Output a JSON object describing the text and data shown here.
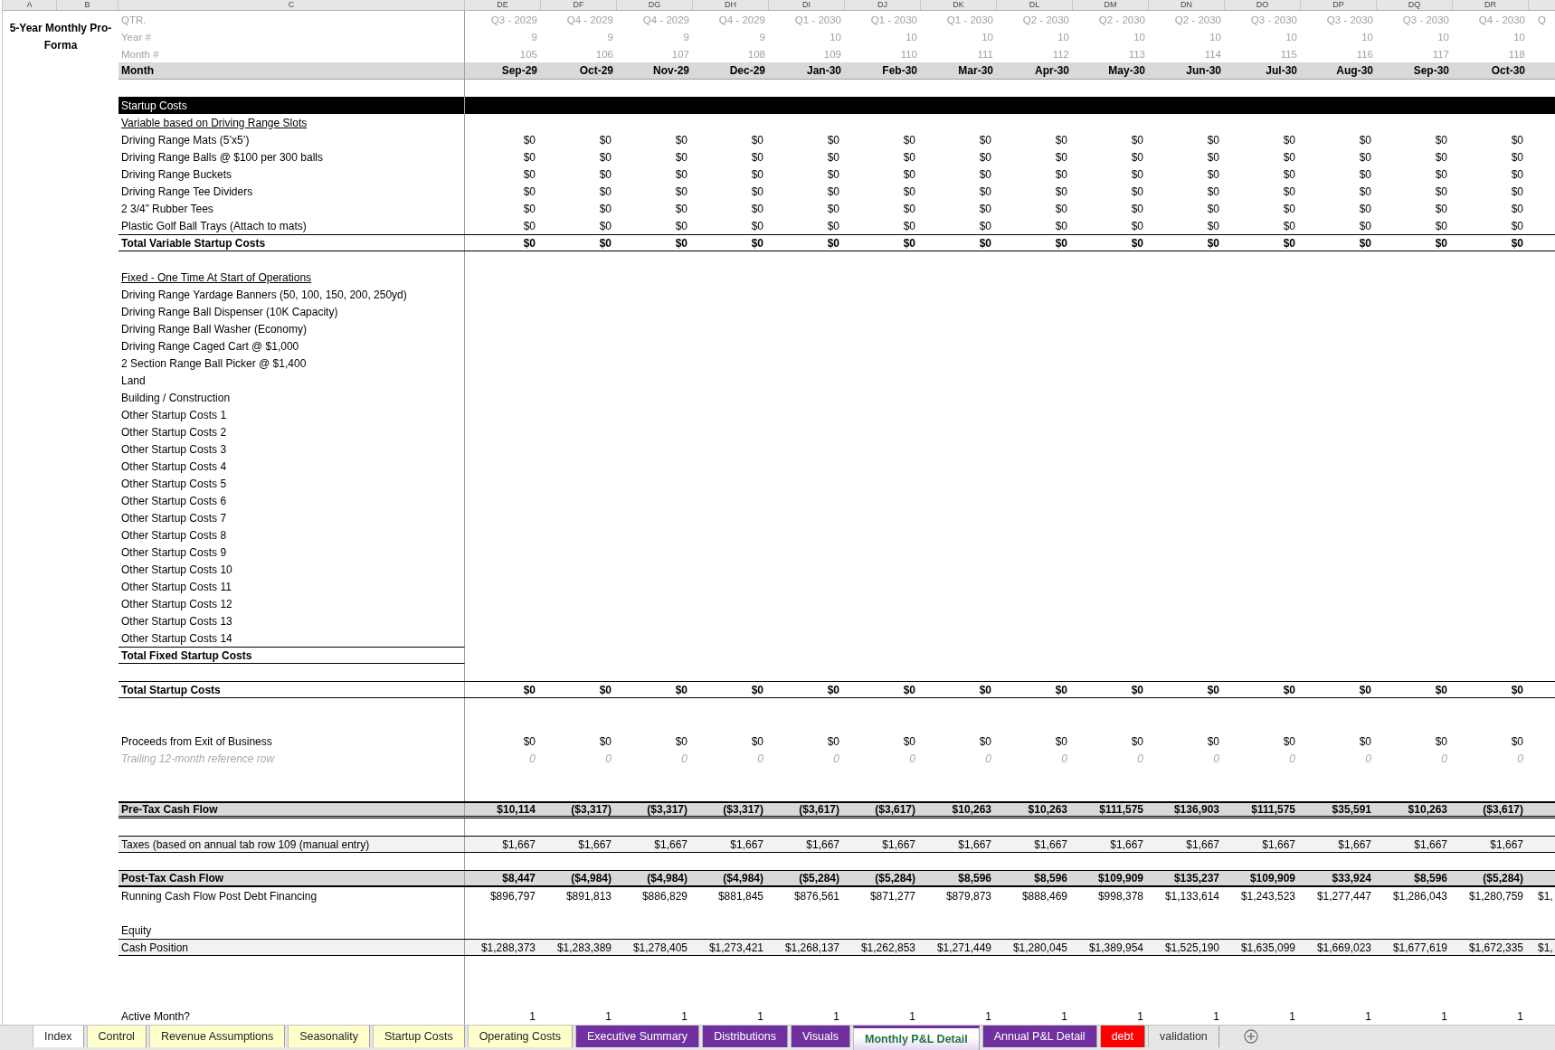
{
  "column_letters": [
    "A",
    "B",
    "C",
    "DE",
    "DF",
    "DG",
    "DH",
    "DI",
    "DJ",
    "DK",
    "DL",
    "DM",
    "DN",
    "DO",
    "DP",
    "DQ",
    "DR"
  ],
  "title": "5-Year Monthly Pro-Forma",
  "header_rows": [
    {
      "label": "QTR.",
      "values": [
        "Q3 - 2029",
        "Q4 - 2029",
        "Q4 - 2029",
        "Q4 - 2029",
        "Q1 - 2030",
        "Q1 - 2030",
        "Q1 - 2030",
        "Q2 - 2030",
        "Q2 - 2030",
        "Q2 - 2030",
        "Q3 - 2030",
        "Q3 - 2030",
        "Q3 - 2030",
        "Q4 - 2030",
        "Q"
      ]
    },
    {
      "label": "Year #",
      "values": [
        "9",
        "9",
        "9",
        "9",
        "10",
        "10",
        "10",
        "10",
        "10",
        "10",
        "10",
        "10",
        "10",
        "10"
      ]
    },
    {
      "label": "Month #",
      "values": [
        "105",
        "106",
        "107",
        "108",
        "109",
        "110",
        "111",
        "112",
        "113",
        "114",
        "115",
        "116",
        "117",
        "118"
      ]
    }
  ],
  "month_row": {
    "label": "Month",
    "values": [
      "Sep-29",
      "Oct-29",
      "Nov-29",
      "Dec-29",
      "Jan-30",
      "Feb-30",
      "Mar-30",
      "Apr-30",
      "May-30",
      "Jun-30",
      "Jul-30",
      "Aug-30",
      "Sep-30",
      "Oct-30"
    ]
  },
  "rows": [
    {
      "kind": "blank"
    },
    {
      "kind": "section",
      "label": "Startup Costs"
    },
    {
      "kind": "subheader",
      "label": "Variable based on Driving Range Slots"
    },
    {
      "kind": "item",
      "label": "Driving Range Mats (5’x5’)",
      "values": [
        "$0",
        "$0",
        "$0",
        "$0",
        "$0",
        "$0",
        "$0",
        "$0",
        "$0",
        "$0",
        "$0",
        "$0",
        "$0",
        "$0"
      ]
    },
    {
      "kind": "item",
      "label": "Driving Range Balls @ $100 per 300 balls",
      "values": [
        "$0",
        "$0",
        "$0",
        "$0",
        "$0",
        "$0",
        "$0",
        "$0",
        "$0",
        "$0",
        "$0",
        "$0",
        "$0",
        "$0"
      ]
    },
    {
      "kind": "item",
      "label": "Driving Range Buckets",
      "values": [
        "$0",
        "$0",
        "$0",
        "$0",
        "$0",
        "$0",
        "$0",
        "$0",
        "$0",
        "$0",
        "$0",
        "$0",
        "$0",
        "$0"
      ]
    },
    {
      "kind": "item",
      "label": "Driving Range Tee Dividers",
      "values": [
        "$0",
        "$0",
        "$0",
        "$0",
        "$0",
        "$0",
        "$0",
        "$0",
        "$0",
        "$0",
        "$0",
        "$0",
        "$0",
        "$0"
      ]
    },
    {
      "kind": "item",
      "label": "2 3/4” Rubber Tees",
      "values": [
        "$0",
        "$0",
        "$0",
        "$0",
        "$0",
        "$0",
        "$0",
        "$0",
        "$0",
        "$0",
        "$0",
        "$0",
        "$0",
        "$0"
      ]
    },
    {
      "kind": "item",
      "label": "Plastic Golf Ball Trays (Attach to mats)",
      "values": [
        "$0",
        "$0",
        "$0",
        "$0",
        "$0",
        "$0",
        "$0",
        "$0",
        "$0",
        "$0",
        "$0",
        "$0",
        "$0",
        "$0"
      ]
    },
    {
      "kind": "total",
      "label": "Total Variable Startup Costs",
      "values": [
        "$0",
        "$0",
        "$0",
        "$0",
        "$0",
        "$0",
        "$0",
        "$0",
        "$0",
        "$0",
        "$0",
        "$0",
        "$0",
        "$0"
      ]
    },
    {
      "kind": "blank"
    },
    {
      "kind": "subheader",
      "label": "Fixed - One Time At Start of Operations"
    },
    {
      "kind": "item",
      "label": "Driving Range Yardage Banners (50, 100, 150, 200, 250yd)"
    },
    {
      "kind": "item",
      "label": "Driving Range Ball Dispenser (10K Capacity)"
    },
    {
      "kind": "item",
      "label": "Driving Range Ball Washer (Economy)"
    },
    {
      "kind": "item",
      "label": "Driving Range Caged Cart @ $1,000"
    },
    {
      "kind": "item",
      "label": "2 Section Range Ball Picker @ $1,400"
    },
    {
      "kind": "item",
      "label": "Land"
    },
    {
      "kind": "item",
      "label": "Building / Construction"
    },
    {
      "kind": "item",
      "label": "Other Startup Costs 1"
    },
    {
      "kind": "item",
      "label": "Other Startup Costs 2"
    },
    {
      "kind": "item",
      "label": "Other Startup Costs 3"
    },
    {
      "kind": "item",
      "label": "Other Startup Costs 4"
    },
    {
      "kind": "item",
      "label": "Other Startup Costs 5"
    },
    {
      "kind": "item",
      "label": "Other Startup Costs 6"
    },
    {
      "kind": "item",
      "label": "Other Startup Costs 7"
    },
    {
      "kind": "item",
      "label": "Other Startup Costs 8"
    },
    {
      "kind": "item",
      "label": "Other Startup Costs 9"
    },
    {
      "kind": "item",
      "label": "Other Startup Costs 10"
    },
    {
      "kind": "item",
      "label": "Other Startup Costs 11"
    },
    {
      "kind": "item",
      "label": "Other Startup Costs 12"
    },
    {
      "kind": "item",
      "label": "Other Startup Costs 13"
    },
    {
      "kind": "item",
      "label": "Other Startup Costs 14"
    },
    {
      "kind": "label-total",
      "label": "Total Fixed Startup Costs"
    },
    {
      "kind": "blank"
    },
    {
      "kind": "total",
      "label": "Total Startup Costs",
      "values": [
        "$0",
        "$0",
        "$0",
        "$0",
        "$0",
        "$0",
        "$0",
        "$0",
        "$0",
        "$0",
        "$0",
        "$0",
        "$0",
        "$0"
      ]
    },
    {
      "kind": "blank"
    },
    {
      "kind": "blank"
    },
    {
      "kind": "item",
      "label": "Proceeds from Exit of Business",
      "values": [
        "$0",
        "$0",
        "$0",
        "$0",
        "$0",
        "$0",
        "$0",
        "$0",
        "$0",
        "$0",
        "$0",
        "$0",
        "$0",
        "$0"
      ]
    },
    {
      "kind": "reference",
      "label": "Trailing 12-month reference row",
      "values": [
        "0",
        "0",
        "0",
        "0",
        "0",
        "0",
        "0",
        "0",
        "0",
        "0",
        "0",
        "0",
        "0",
        "0"
      ]
    },
    {
      "kind": "blank"
    },
    {
      "kind": "blank"
    },
    {
      "kind": "cashflow",
      "label": "Pre-Tax Cash Flow",
      "values": [
        "$10,114",
        "($3,317)",
        "($3,317)",
        "($3,317)",
        "($3,617)",
        "($3,617)",
        "$10,263",
        "$10,263",
        "$111,575",
        "$136,903",
        "$111,575",
        "$35,591",
        "$10,263",
        "($3,617)"
      ]
    },
    {
      "kind": "blank"
    },
    {
      "kind": "shaded",
      "label": "Taxes (based on annual tab row 109 (manual entry)",
      "values": [
        "$1,667",
        "$1,667",
        "$1,667",
        "$1,667",
        "$1,667",
        "$1,667",
        "$1,667",
        "$1,667",
        "$1,667",
        "$1,667",
        "$1,667",
        "$1,667",
        "$1,667",
        "$1,667"
      ]
    },
    {
      "kind": "blank"
    },
    {
      "kind": "post-cashflow",
      "label": "Post-Tax Cash Flow",
      "values": [
        "$8,447",
        "($4,984)",
        "($4,984)",
        "($4,984)",
        "($5,284)",
        "($5,284)",
        "$8,596",
        "$8,596",
        "$109,909",
        "$135,237",
        "$109,909",
        "$33,924",
        "$8,596",
        "($5,284)"
      ]
    },
    {
      "kind": "item",
      "label": "Running Cash Flow Post Debt Financing",
      "values": [
        "$896,797",
        "$891,813",
        "$886,829",
        "$881,845",
        "$876,561",
        "$871,277",
        "$879,873",
        "$888,469",
        "$998,378",
        "$1,133,614",
        "$1,243,523",
        "$1,277,447",
        "$1,286,043",
        "$1,280,759",
        "$1,"
      ]
    },
    {
      "kind": "blank"
    },
    {
      "kind": "item",
      "label": "Equity"
    },
    {
      "kind": "shaded",
      "label": "Cash Position",
      "values": [
        "$1,288,373",
        "$1,283,389",
        "$1,278,405",
        "$1,273,421",
        "$1,268,137",
        "$1,262,853",
        "$1,271,449",
        "$1,280,045",
        "$1,389,954",
        "$1,525,190",
        "$1,635,099",
        "$1,669,023",
        "$1,677,619",
        "$1,672,335",
        "$1,"
      ]
    },
    {
      "kind": "blank"
    },
    {
      "kind": "blank"
    },
    {
      "kind": "blank"
    },
    {
      "kind": "item",
      "label": "Active Month?",
      "values": [
        "1",
        "1",
        "1",
        "1",
        "1",
        "1",
        "1",
        "1",
        "1",
        "1",
        "1",
        "1",
        "1",
        "1"
      ]
    }
  ],
  "sheet_tabs": [
    {
      "label": "Index",
      "color": "#ffffff",
      "selected": false
    },
    {
      "label": "Control",
      "color": "#ffffcc",
      "selected": false
    },
    {
      "label": "Revenue Assumptions",
      "color": "#ffffcc",
      "selected": false
    },
    {
      "label": "Seasonality",
      "color": "#ffffcc",
      "selected": false
    },
    {
      "label": "Startup Costs",
      "color": "#ffffcc",
      "selected": false
    },
    {
      "label": "Operating Costs",
      "color": "#ffffcc",
      "selected": false
    },
    {
      "label": "Executive Summary",
      "color": "#7030a0",
      "selected": false
    },
    {
      "label": "Distributions",
      "color": "#7030a0",
      "selected": false
    },
    {
      "label": "Visuals",
      "color": "#7030a0",
      "selected": false
    },
    {
      "label": "Monthly P&L Detail",
      "color": "#7030a0",
      "selected": true
    },
    {
      "label": "Annual P&L Detail",
      "color": "#7030a0",
      "selected": false
    },
    {
      "label": "debt",
      "color": "#ff0000",
      "selected": false
    },
    {
      "label": "validation",
      "selected": false
    }
  ]
}
